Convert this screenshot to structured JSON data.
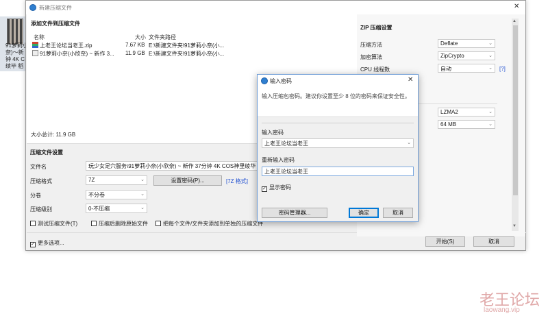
{
  "desktop": {
    "file_label": "91萝莉小\n奈)～新\n钟 4K C\n续毕 稻"
  },
  "window": {
    "title": "新建压缩文件",
    "close_glyph": "✕"
  },
  "add_files": {
    "section_title": "添加文件到压缩文件",
    "col_name": "名称",
    "col_size": "大小",
    "col_path": "文件夹路径",
    "rows": [
      {
        "name": "上老王论坛当老王.zip",
        "size": "7.67 KB",
        "path": "E:\\新建文件夹\\91萝莉小奈(小..."
      },
      {
        "name": "91萝莉小奈(小欣奈) ~ 新作 3...",
        "size": "11.9 GB",
        "path": "E:\\新建文件夹\\91萝莉小奈(小..."
      }
    ],
    "total_label": "大小总计: 11.9 GB"
  },
  "settings": {
    "section_title": "压缩文件设置",
    "filename_label": "文件名",
    "filename_value": "玩少女足穴服务\\91萝莉小奈(小欣奈) ~ 新作 37分钟 4K COS神里绫华 稻",
    "format_label": "压缩格式",
    "format_value": "7Z",
    "set_password_btn": "设置密码(P)...",
    "format_link": "[7Z 格式]",
    "split_label": "分卷",
    "split_value": "不分卷",
    "level_label": "压缩级别",
    "level_value": "0-不压缩",
    "test_label": "测试压缩文件(T)",
    "delete_label": "压缩后删除原始文件",
    "separate_label": "把每个文件/文件夹添加到单独的压缩文件",
    "more_label": "更多选项...",
    "start_btn": "开始(S)",
    "cancel_btn": "取消"
  },
  "zip": {
    "section_title": "ZIP 压缩设置",
    "method_label": "压缩方法",
    "method_value": "Deflate",
    "encrypt_label": "加密算法",
    "encrypt_value": "ZipCrypto",
    "cpu_label": "CPU 线程数",
    "cpu_value": "自动",
    "cpu_help": "[?]",
    "algo_value": "LZMA2",
    "dict_value": "64 MB"
  },
  "dialog": {
    "title": "输入密码",
    "close_glyph": "✕",
    "hint": "输入压缩包密码。建议你设置至少 8 位的密码来保证安全性。",
    "pwd_label": "输入密码",
    "pwd_value": "上老王论坛当老王",
    "repeat_label": "重新输入密码",
    "repeat_value": "上老王论坛当老王",
    "show_label": "显示密码",
    "manager_btn": "密码管理器...",
    "ok_btn": "确定",
    "cancel_btn": "取消"
  },
  "watermark": {
    "line1": "老王论坛",
    "line2": "laowang.vip"
  }
}
